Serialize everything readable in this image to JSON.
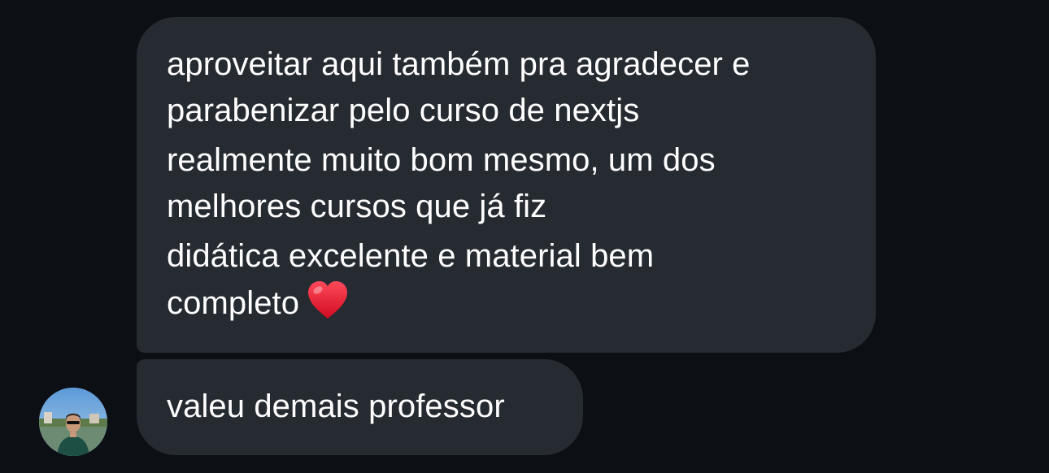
{
  "conversation": {
    "messages": [
      {
        "lines": [
          "aproveitar aqui também pra agradecer e",
          "parabenizar pelo curso de nextjs"
        ]
      },
      {
        "lines": [
          "realmente muito bom mesmo, um dos",
          "melhores cursos que já fiz"
        ]
      },
      {
        "lines": [
          "didática excelente e material bem",
          "completo"
        ],
        "emoji": "red-heart"
      },
      {
        "lines": [
          "valeu demais professor"
        ]
      }
    ]
  },
  "colors": {
    "background": "#0c0f14",
    "bubble": "#262a31",
    "text": "#ffffff",
    "heart": "#e8122a"
  },
  "icons": {
    "heart": "red-heart-emoji",
    "avatar": "profile-photo"
  }
}
